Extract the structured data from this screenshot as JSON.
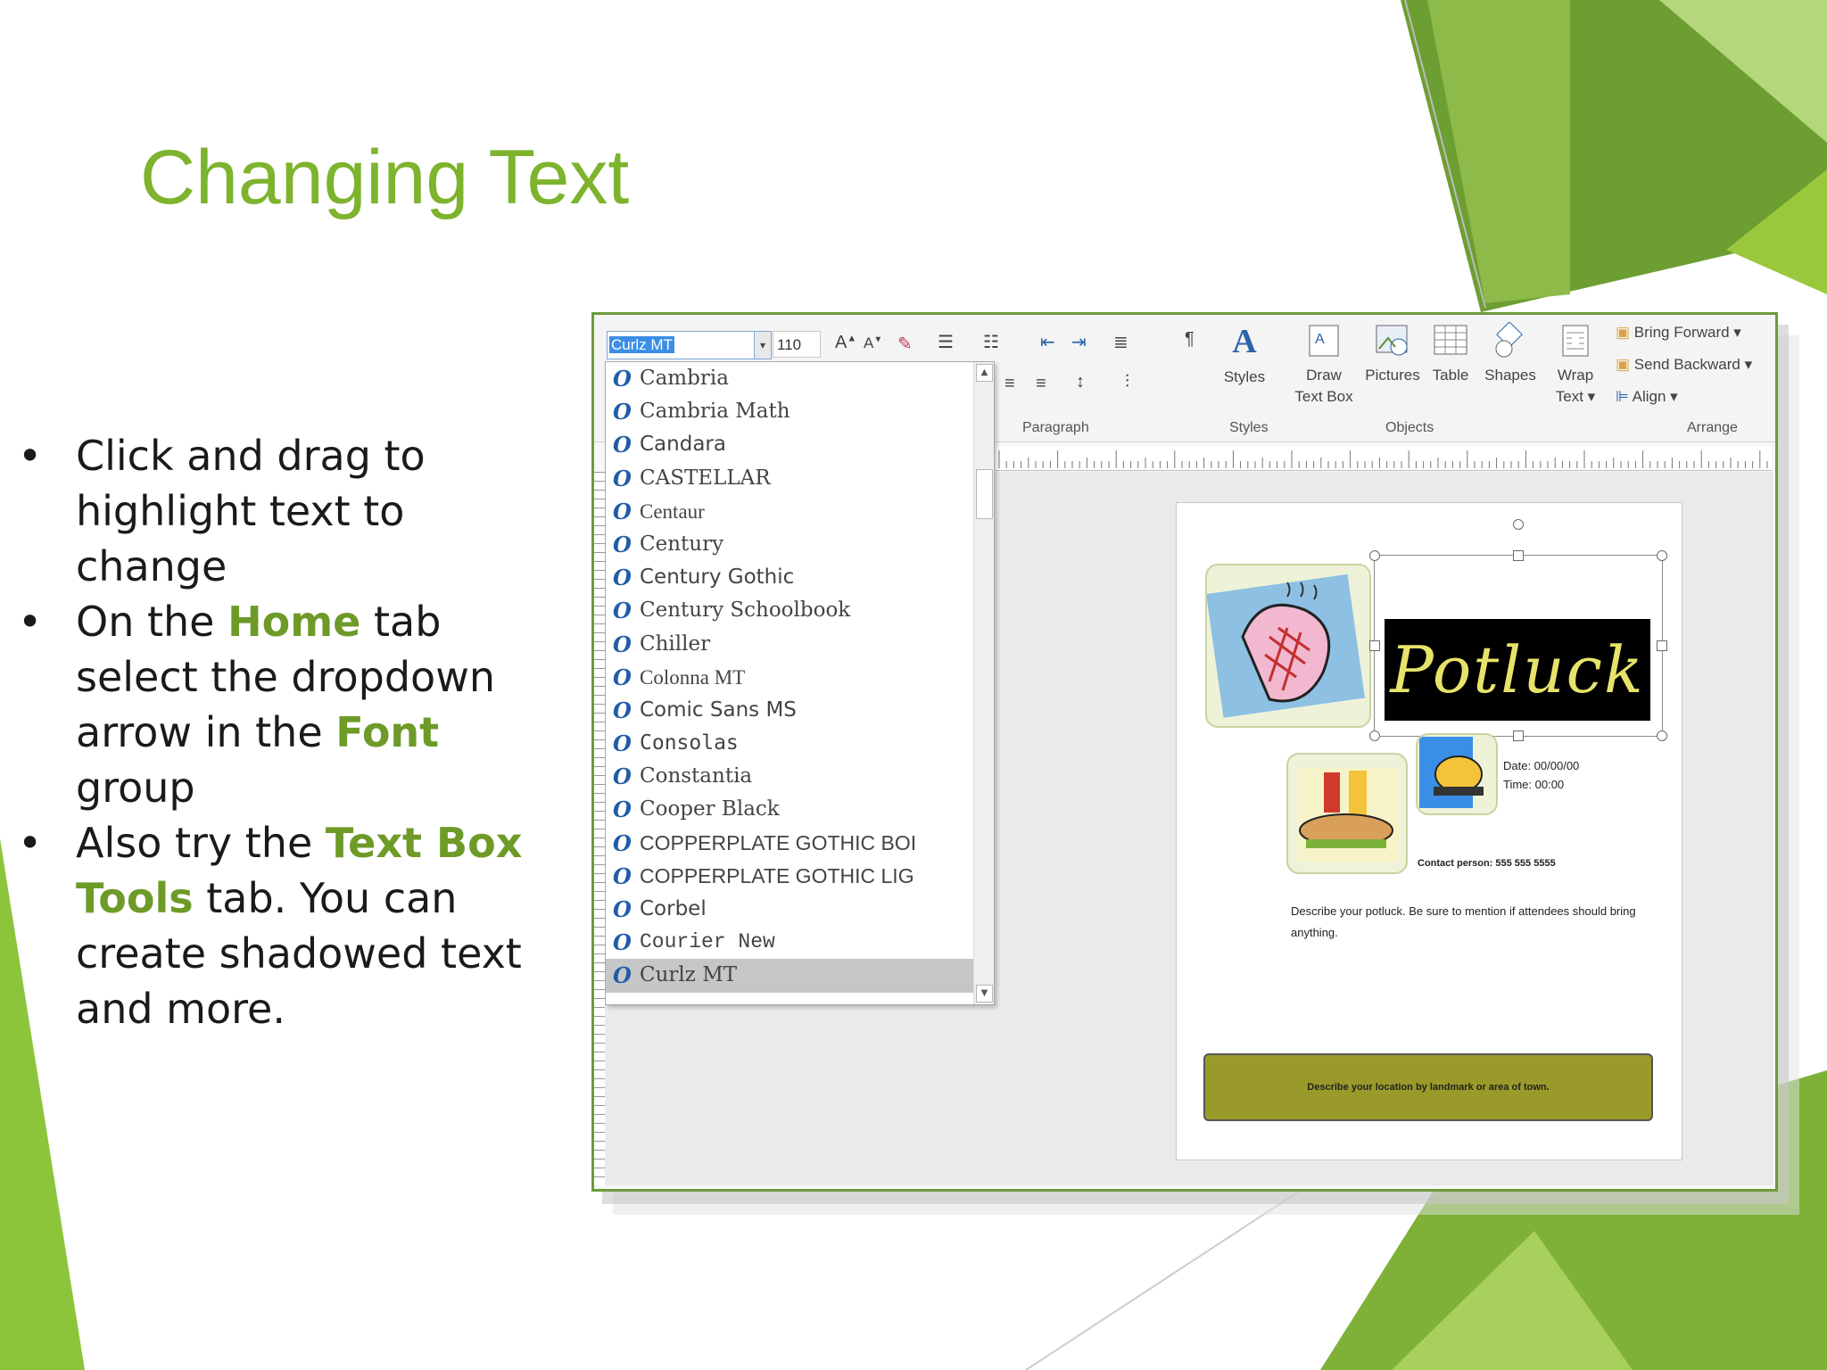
{
  "slide": {
    "title": "Changing Text",
    "bullets": [
      {
        "parts": [
          {
            "text": "Click and drag to highlight text to change",
            "hl": false
          }
        ]
      },
      {
        "parts": [
          {
            "text": "On the ",
            "hl": false
          },
          {
            "text": "Home",
            "hl": true
          },
          {
            "text": " tab select the dropdown arrow in the ",
            "hl": false
          },
          {
            "text": "Font",
            "hl": true
          },
          {
            "text": " group",
            "hl": false
          }
        ]
      },
      {
        "parts": [
          {
            "text": "Also try the ",
            "hl": false
          },
          {
            "text": "Text Box Tools",
            "hl": true
          },
          {
            "text": " tab. You can create shadowed text and more.",
            "hl": false
          }
        ]
      }
    ],
    "bullet_char": "•"
  },
  "ribbon": {
    "font_name": "Curlz MT",
    "font_size": "110",
    "dropdown_arrow": "▾",
    "pilcrow": "¶",
    "groups": {
      "paragraph": "Paragraph",
      "styles": "Styles",
      "objects": "Objects",
      "arrange": "Arrange"
    },
    "styles_label": "Styles",
    "draw_text_box": [
      "Draw",
      "Text Box"
    ],
    "pictures": "Pictures",
    "table": "Table",
    "shapes": "Shapes",
    "wrap_text": [
      "Wrap",
      "Text ▾"
    ],
    "bring_forward": "Bring Forward",
    "send_backward": "Send Backward",
    "align": "Align ▾"
  },
  "font_list": {
    "selected": "Curlz MT",
    "items": [
      {
        "name": "Cambria",
        "font": "DejaVu Serif"
      },
      {
        "name": "Cambria Math",
        "font": "DejaVu Serif"
      },
      {
        "name": "Candara",
        "font": "DejaVu Sans"
      },
      {
        "name": "CASTELLAR",
        "font": "DejaVu Serif"
      },
      {
        "name": "Centaur",
        "font": "Liberation Serif"
      },
      {
        "name": "Century",
        "font": "DejaVu Serif"
      },
      {
        "name": "Century Gothic",
        "font": "DejaVu Sans"
      },
      {
        "name": "Century Schoolbook",
        "font": "DejaVu Serif"
      },
      {
        "name": "Chiller",
        "font": "DejaVu Serif"
      },
      {
        "name": "Colonna MT",
        "font": "Liberation Serif"
      },
      {
        "name": "Comic Sans MS",
        "font": "DejaVu Sans"
      },
      {
        "name": "Consolas",
        "font": "DejaVu Sans Mono"
      },
      {
        "name": "Constantia",
        "font": "DejaVu Serif"
      },
      {
        "name": "Cooper Black",
        "font": "DejaVu Serif"
      },
      {
        "name": "COPPERPLATE GOTHIC BOI",
        "font": "Liberation Sans"
      },
      {
        "name": "COPPERPLATE GOTHIC LIG",
        "font": "Liberation Sans"
      },
      {
        "name": "Corbel",
        "font": "DejaVu Sans"
      },
      {
        "name": "Courier New",
        "font": "Liberation Mono"
      },
      {
        "name": "Curlz MT",
        "font": "DejaVu Serif"
      }
    ]
  },
  "flyer": {
    "headline": "Potluck",
    "date": "Date: 00/00/00",
    "time": "Time: 00:00",
    "contact": "Contact person: 555 555 5555",
    "description": "Describe your potluck. Be sure to mention if attendees should bring anything.",
    "location": "Describe your location by landmark or area of town."
  },
  "colors": {
    "accent": "#7db32d",
    "highlight": "#6e9a28",
    "border": "#6c9a3c"
  }
}
